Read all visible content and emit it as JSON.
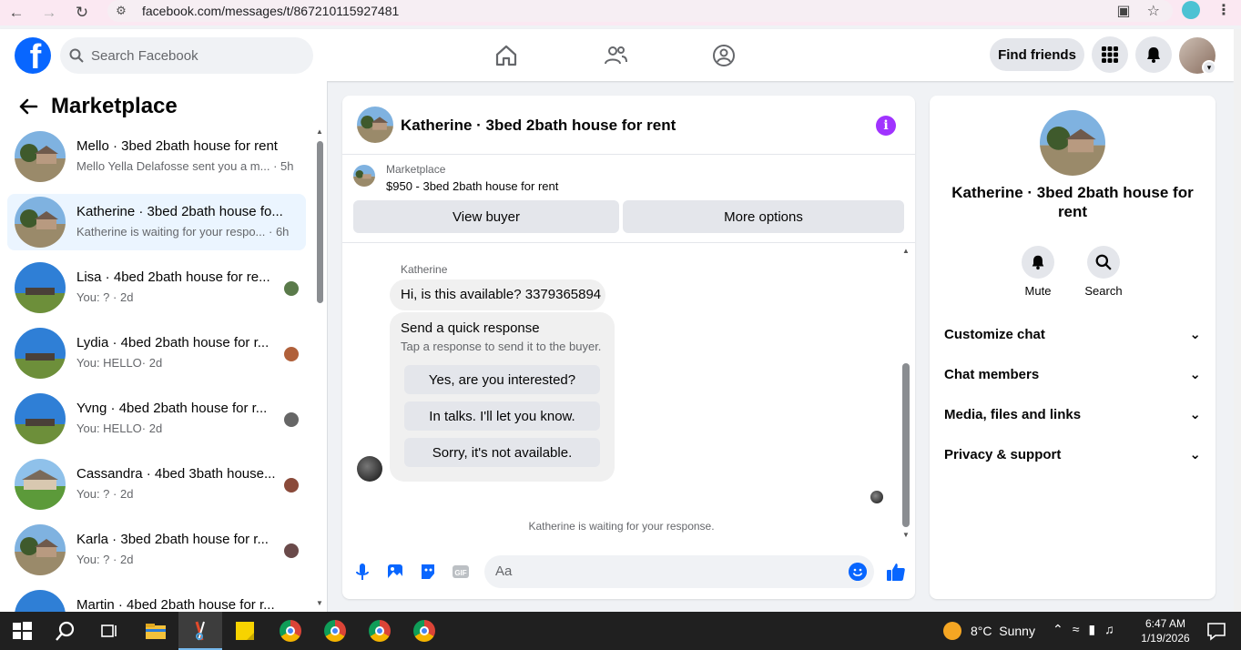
{
  "browser": {
    "url": "facebook.com/messages/t/867210115927481"
  },
  "header": {
    "search_placeholder": "Search Facebook",
    "find_friends": "Find friends"
  },
  "sidebar": {
    "title": "Marketplace",
    "conversations": [
      {
        "title": "Mello · 3bed 2bath house for rent",
        "preview": "Mello Yella Delafosse sent you a m...",
        "time": "· 5h"
      },
      {
        "title": "Katherine · 3bed 2bath house fo...",
        "preview": "Katherine is waiting for your respo...",
        "time": "· 6h"
      },
      {
        "title": "Lisa · 4bed 2bath house for re...",
        "preview": "You: ?",
        "time": "· 2d"
      },
      {
        "title": "Lydia · 4bed 2bath house for r...",
        "preview": "You: HELLO",
        "time": "· 2d"
      },
      {
        "title": "Yvng · 4bed 2bath house for r...",
        "preview": "You: HELLO",
        "time": "· 2d"
      },
      {
        "title": "Cassandra · 4bed 3bath house...",
        "preview": "You: ?",
        "time": "· 2d"
      },
      {
        "title": "Karla · 3bed 2bath house for r...",
        "preview": "You: ?",
        "time": "· 2d"
      },
      {
        "title": "Martin · 4bed 2bath house for r...",
        "preview": "",
        "time": ""
      }
    ]
  },
  "chat": {
    "title": "Katherine · 3bed 2bath house for rent",
    "marketplace_label": "Marketplace",
    "listing": "$950 - 3bed 2bath house for rent",
    "view_buyer": "View buyer",
    "more_options": "More options",
    "sender": "Katherine",
    "message": "Hi, is this available? 3379365894",
    "quick_title": "Send a quick response",
    "quick_sub": "Tap a response to send it to the buyer.",
    "quick_replies": [
      "Yes, are you interested?",
      "In talks. I'll let you know.",
      "Sorry, it's not available."
    ],
    "waiting": "Katherine is waiting for your response.",
    "composer_placeholder": "Aa"
  },
  "info": {
    "name": "Katherine · 3bed 2bath house for rent",
    "mute": "Mute",
    "search": "Search",
    "rows": [
      "Customize chat",
      "Chat members",
      "Media, files and links",
      "Privacy & support"
    ]
  },
  "taskbar": {
    "weather": "8°C  Sunny",
    "time": "6:47 AM",
    "date": "1/19/2026"
  },
  "colors": {
    "fb_blue": "#0866ff",
    "active_bg": "#ebf5ff",
    "info_purple": "#a033ff"
  }
}
